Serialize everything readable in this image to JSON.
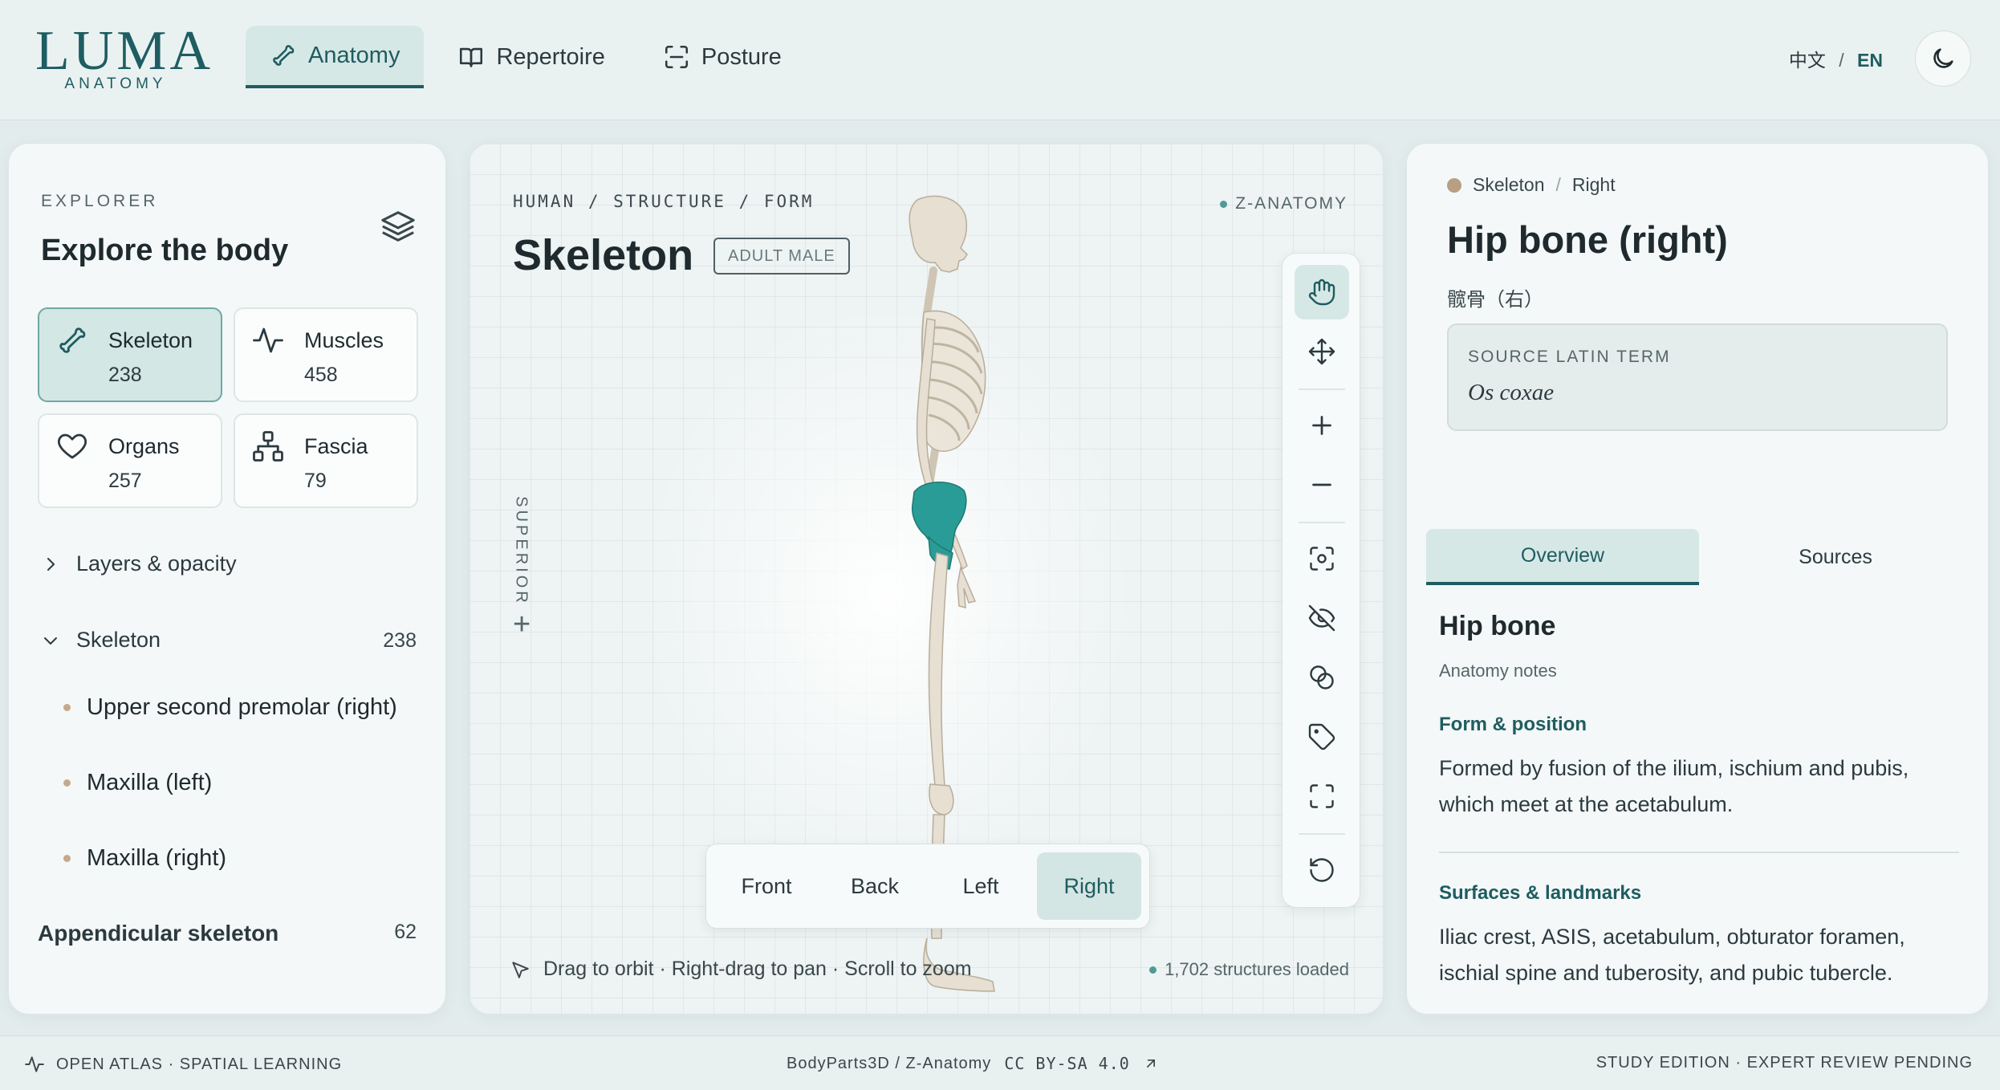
{
  "brand": {
    "name": "LUMA",
    "sub": "ANATOMY"
  },
  "nav": {
    "anatomy": "Anatomy",
    "repertoire": "Repertoire",
    "posture": "Posture"
  },
  "lang": {
    "zh": "中文",
    "sep": "/",
    "en": "EN"
  },
  "explorer": {
    "eyebrow": "EXPLORER",
    "title": "Explore the body",
    "categories": [
      {
        "label": "Skeleton",
        "count": "238"
      },
      {
        "label": "Muscles",
        "count": "458"
      },
      {
        "label": "Organs",
        "count": "257"
      },
      {
        "label": "Fascia",
        "count": "79"
      }
    ],
    "layers_label": "Layers & opacity",
    "group": {
      "label": "Skeleton",
      "count": "238"
    },
    "items": [
      "Upper second premolar (right)",
      "Maxilla (left)",
      "Maxilla (right)"
    ],
    "subgroup": {
      "label": "Appendicular skeleton",
      "count": "62"
    }
  },
  "viewer": {
    "breadcrumb": "HUMAN / STRUCTURE / FORM",
    "title": "Skeleton",
    "badge": "ADULT MALE",
    "source": "Z-ANATOMY",
    "axis_label": "SUPERIOR",
    "views": [
      "Front",
      "Back",
      "Left",
      "Right"
    ],
    "active_view": "Right",
    "hint": "Drag to orbit · Right-drag to pan · Scroll to zoom",
    "loaded": "1,702 structures loaded",
    "tools": [
      "hand-icon",
      "move-icon",
      "zoom-in-icon",
      "zoom-out-icon",
      "focus-icon",
      "hide-icon",
      "isolate-icon",
      "tag-icon",
      "fullscreen-icon",
      "reset-icon"
    ],
    "highlight_color": "#2a9c97"
  },
  "detail": {
    "crumb_a": "Skeleton",
    "crumb_sep": "/",
    "crumb_b": "Right",
    "title": "Hip bone (right)",
    "cn_name": "髋骨（右）",
    "latin_label": "SOURCE LATIN TERM",
    "latin_value": "Os coxae",
    "tabs": [
      "Overview",
      "Sources"
    ],
    "section_title": "Hip bone",
    "section_sub": "Anatomy notes",
    "form_title": "Form & position",
    "form_text": "Formed by fusion of the ilium, ischium and pubis, which meet at the acetabulum.",
    "surfaces_title": "Surfaces & landmarks",
    "surfaces_text": "Iliac crest, ASIS, acetabulum, obturator foramen, ischial spine and tuberosity, and pubic tubercle."
  },
  "footer": {
    "left": "OPEN ATLAS · SPATIAL LEARNING",
    "mid": "BodyParts3D / Z-Anatomy",
    "license": "CC BY-SA 4.0",
    "right": "STUDY EDITION · EXPERT REVIEW PENDING"
  },
  "colors": {
    "accent": "#1f5c60",
    "panel": "#f4f8f8",
    "bg": "#e3ecec"
  }
}
